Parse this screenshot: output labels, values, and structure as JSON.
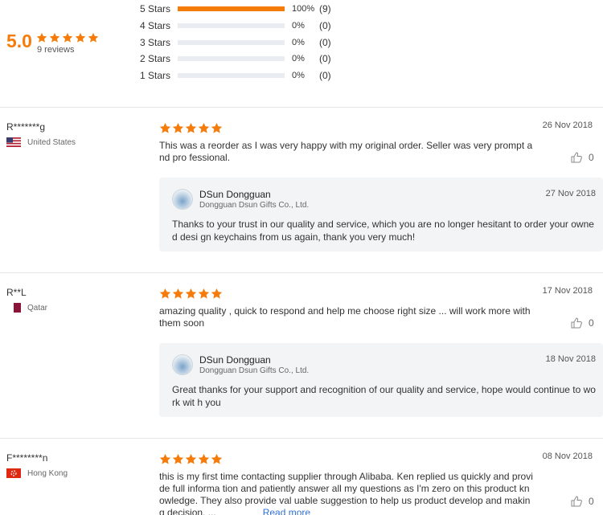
{
  "summary": {
    "score": "5.0",
    "reviews": "9 reviews",
    "distribution": [
      {
        "label": "5 Stars",
        "pct": "100%",
        "count": "(9)",
        "fraction": 1.0
      },
      {
        "label": "4 Stars",
        "pct": "0%",
        "count": "(0)",
        "fraction": 0
      },
      {
        "label": "3 Stars",
        "pct": "0%",
        "count": "(0)",
        "fraction": 0
      },
      {
        "label": "2 Stars",
        "pct": "0%",
        "count": "(0)",
        "fraction": 0
      },
      {
        "label": "1 Stars",
        "pct": "0%",
        "count": "(0)",
        "fraction": 0
      }
    ]
  },
  "colors": {
    "accent": "#f57c0a",
    "link": "#2f6fd3",
    "reply_bg": "#f3f4f6"
  },
  "reviews": [
    {
      "reviewer": "R*******g",
      "country": "United States",
      "flag": "us-flag",
      "rating": 5,
      "date": "26 Nov 2018",
      "text": "This was a reorder as I was very happy with my original order. Seller was very prompt and pro fessional.",
      "likes": "0",
      "reply": {
        "name": "DSun Dongguan",
        "company": "Dongguan Dsun Gifts Co., Ltd.",
        "date": "27 Nov 2018",
        "text": "Thanks to your trust in our quality and service, which you are no longer hesitant to order your owned desi gn keychains from us again, thank you very much!"
      }
    },
    {
      "reviewer": "R**L",
      "country": "Qatar",
      "flag": "qatar-flag",
      "rating": 5,
      "date": "17 Nov 2018",
      "text": "amazing quality , quick to respond and help me choose right size ... will work more with them soon",
      "likes": "0",
      "reply": {
        "name": "DSun Dongguan",
        "company": "Dongguan Dsun Gifts Co., Ltd.",
        "date": "18 Nov 2018",
        "text": "Great thanks for your support and recognition of our quality and service, hope would continue to work wit h you"
      }
    },
    {
      "reviewer": "F********n",
      "country": "Hong Kong",
      "flag": "hong-kong-flag",
      "rating": 5,
      "date": "08 Nov 2018",
      "text": "this is my first time contacting supplier through Alibaba. Ken replied us quickly and provide full informa tion and patiently answer all my questions as I'm zero on this product knowledge.  They also provide val uable suggestion to help us product develop and making decision.  ...",
      "read_more": "Read more",
      "likes": "0"
    }
  ]
}
